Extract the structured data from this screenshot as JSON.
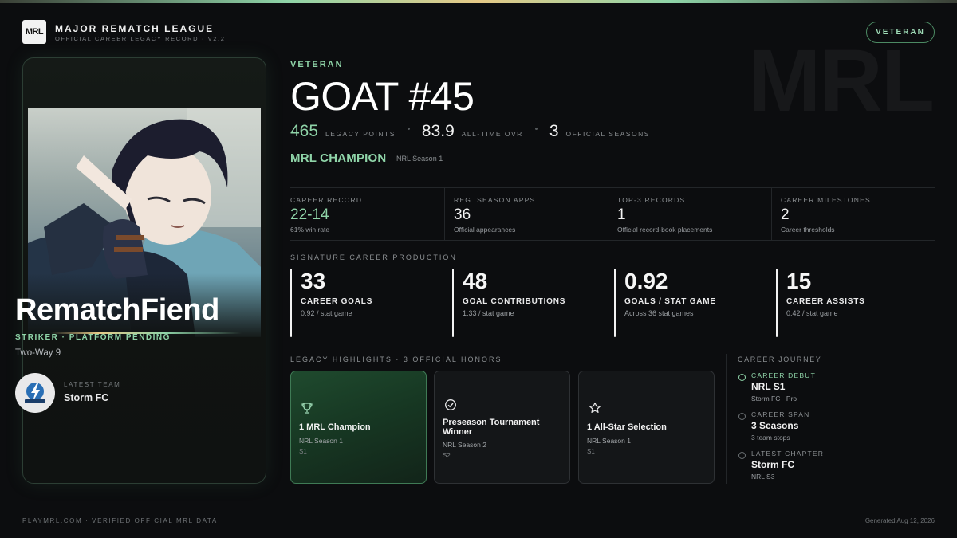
{
  "header": {
    "logo_text": "MRL",
    "league_name": "MAJOR REMATCH LEAGUE",
    "league_sub": "OFFICIAL CAREER LEGACY RECORD · V2.2",
    "tier_badge": "VETERAN",
    "watermark": "MRL"
  },
  "player": {
    "name": "RematchFiend",
    "role": "STRIKER · PLATFORM PENDING",
    "mode": "Two-Way 9",
    "latest_team_label": "LATEST TEAM",
    "latest_team": "Storm FC"
  },
  "summary": {
    "tier": "VETERAN",
    "title": "GOAT #45",
    "legacy_points": "465",
    "legacy_points_label": "LEGACY POINTS",
    "ovr": "83.9",
    "ovr_label": "ALL-TIME OVR",
    "seasons": "3",
    "seasons_label": "OFFICIAL SEASONS",
    "champion": "MRL CHAMPION",
    "champion_sub": "NRL Season 1"
  },
  "records": [
    {
      "label": "CAREER RECORD",
      "value": "22-14",
      "note": "61% win rate"
    },
    {
      "label": "REG. SEASON APPS",
      "value": "36",
      "note": "Official appearances"
    },
    {
      "label": "TOP-3 RECORDS",
      "value": "1",
      "note": "Official record-book placements"
    },
    {
      "label": "CAREER MILESTONES",
      "value": "2",
      "note": "Career thresholds"
    }
  ],
  "production": {
    "label": "SIGNATURE CAREER PRODUCTION",
    "items": [
      {
        "value": "33",
        "label": "CAREER GOALS",
        "note": "0.92 / stat game"
      },
      {
        "value": "48",
        "label": "GOAL CONTRIBUTIONS",
        "note": "1.33 / stat game"
      },
      {
        "value": "0.92",
        "label": "GOALS / STAT GAME",
        "note": "Across 36 stat games"
      },
      {
        "value": "15",
        "label": "CAREER ASSISTS",
        "note": "0.42 / stat game"
      }
    ]
  },
  "highlights": {
    "label": "LEGACY HIGHLIGHTS · 3 OFFICIAL HONORS",
    "items": [
      {
        "icon": "trophy-icon",
        "title": "1 MRL Champion",
        "sub": "NRL Season 1",
        "season": "S1"
      },
      {
        "icon": "check-circle-icon",
        "title": "Preseason Tournament Winner",
        "sub": "NRL Season 2",
        "season": "S2"
      },
      {
        "icon": "star-icon",
        "title": "1 All-Star Selection",
        "sub": "NRL Season 1",
        "season": "S1"
      }
    ]
  },
  "journey": {
    "label": "CAREER JOURNEY",
    "items": [
      {
        "label": "CAREER DEBUT",
        "value": "NRL S1",
        "note": "Storm FC · Pro"
      },
      {
        "label": "CAREER SPAN",
        "value": "3 Seasons",
        "note": "3 team stops"
      },
      {
        "label": "LATEST CHAPTER",
        "value": "Storm FC",
        "note": "NRL S3"
      }
    ]
  },
  "footer": {
    "left": "PLAYMRL.COM · VERIFIED OFFICIAL MRL DATA",
    "right": "Generated Aug 12, 2026"
  },
  "colors": {
    "accent": "#8fd4a8",
    "gold": "#e6c987",
    "background": "#0c0d0f"
  }
}
